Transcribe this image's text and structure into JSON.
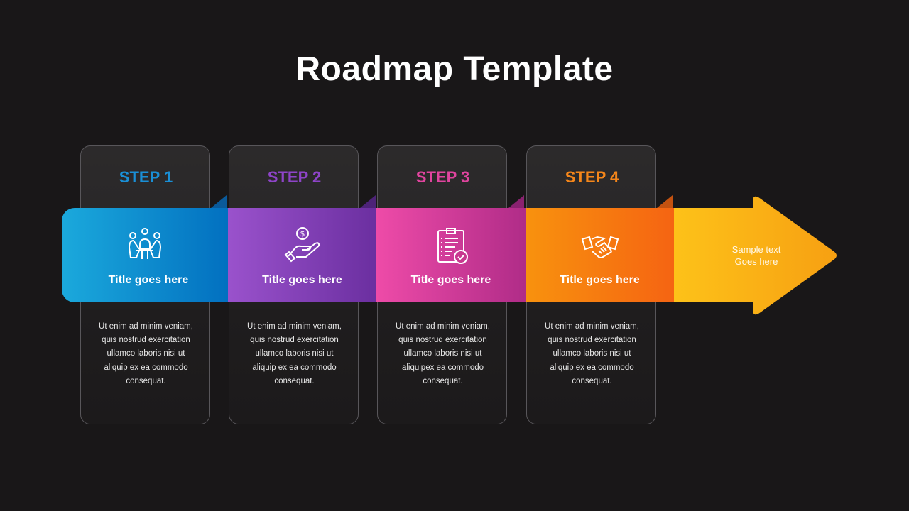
{
  "title": "Roadmap Template",
  "steps": [
    {
      "label": "STEP 1",
      "title": "Title goes here",
      "icon": "team-meeting-icon",
      "color": "#1a8fd6",
      "gradient": [
        "#1ba9dc",
        "#0270c0"
      ],
      "fold_color": "#0a5a9a",
      "desc": [
        "Ut enim ad minim veniam,",
        "quis nostrud exercitation",
        "ullamco laboris nisi ut",
        "aliquip ex ea commodo",
        "consequat."
      ]
    },
    {
      "label": "STEP 2",
      "title": "Title goes here",
      "icon": "money-hand-icon",
      "color": "#8e44c8",
      "gradient": [
        "#9a52cc",
        "#6b2fa0"
      ],
      "fold_color": "#4d2378",
      "desc": [
        "Ut enim ad minim veniam,",
        "quis nostrud exercitation",
        "ullamco laboris nisi ut",
        "aliquip ex ea commodo",
        "consequat."
      ]
    },
    {
      "label": "STEP 3",
      "title": "Title goes here",
      "icon": "clipboard-check-icon",
      "color": "#e0449e",
      "gradient": [
        "#ee4ba8",
        "#b02c88"
      ],
      "fold_color": "#8a2270",
      "desc": [
        "Ut enim ad minim veniam,",
        "quis nostrud exercitation",
        "ullamco laboris nisi ut",
        "aliquipex ea commodo",
        "consequat."
      ]
    },
    {
      "label": "STEP 4",
      "title": "Title goes here",
      "icon": "handshake-icon",
      "color": "#f5861a",
      "gradient": [
        "#f8920e",
        "#f56412"
      ],
      "fold_color": "#c45210",
      "desc": [
        "Ut enim ad minim veniam,",
        "quis nostrud exercitation",
        "ullamco laboris nisi ut",
        "aliquip ex ea commodo",
        "consequat."
      ]
    }
  ],
  "arrow": {
    "text_line1": "Sample text",
    "text_line2": "Goes here",
    "gradient": [
      "#fdc219",
      "#f7a012"
    ]
  }
}
